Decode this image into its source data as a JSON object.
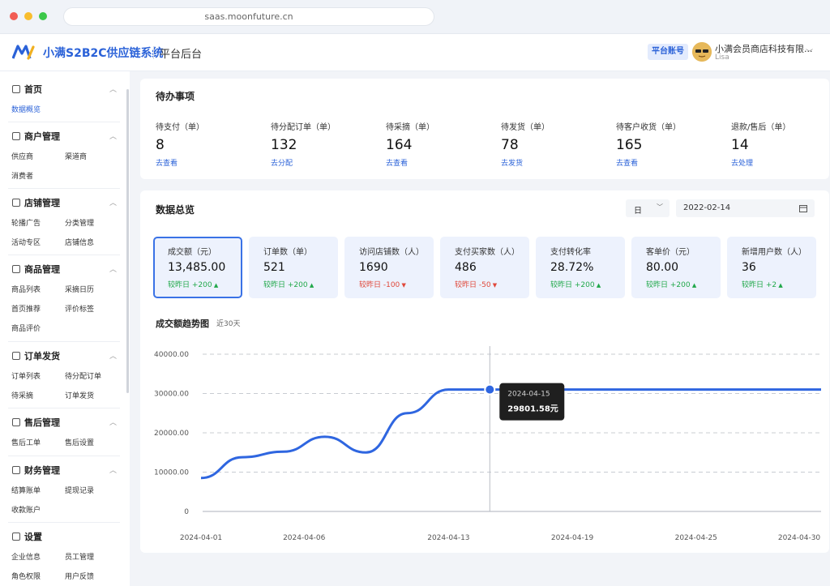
{
  "browser": {
    "url": "saas.moonfuture.cn"
  },
  "header": {
    "brand": "小满S2B2C供应链系统",
    "sub": "平台后台",
    "badge": "平台账号",
    "user_name": "小满会员商店科技有限...",
    "user_sub": "Lisa"
  },
  "sidebar": {
    "groups": [
      {
        "title": "首页",
        "items": [
          "数据概览"
        ]
      },
      {
        "title": "商户管理",
        "items": [
          "供应商",
          "渠道商",
          "消费者"
        ]
      },
      {
        "title": "店铺管理",
        "items": [
          "轮播广告",
          "分类管理",
          "活动专区",
          "店铺信息"
        ]
      },
      {
        "title": "商品管理",
        "items": [
          "商品列表",
          "采摘日历",
          "首页推荐",
          "评价标签",
          "商品评价"
        ]
      },
      {
        "title": "订单发货",
        "items": [
          "订单列表",
          "待分配订单",
          "待采摘",
          "订单发货"
        ]
      },
      {
        "title": "售后管理",
        "items": [
          "售后工单",
          "售后设置"
        ]
      },
      {
        "title": "财务管理",
        "items": [
          "结算账单",
          "提现记录",
          "收款账户"
        ]
      },
      {
        "title": "设置",
        "items": [
          "企业信息",
          "员工管理",
          "角色权限",
          "用户反馈"
        ]
      }
    ]
  },
  "todo": {
    "title": "待办事项",
    "items": [
      {
        "label": "待支付（单）",
        "value": "8",
        "link": "去查看"
      },
      {
        "label": "待分配订单（单）",
        "value": "132",
        "link": "去分配"
      },
      {
        "label": "待采摘（单）",
        "value": "164",
        "link": "去查看"
      },
      {
        "label": "待发货（单）",
        "value": "78",
        "link": "去发货"
      },
      {
        "label": "待客户收货（单）",
        "value": "165",
        "link": "去查看"
      },
      {
        "label": "退款/售后（单）",
        "value": "14",
        "link": "去处理"
      }
    ]
  },
  "overview": {
    "title": "数据总览",
    "period": "日",
    "date": "2022-02-14",
    "kpis": [
      {
        "label": "成交额（元）",
        "value": "13,485.00",
        "delta": "较昨日 +200",
        "trend": "up"
      },
      {
        "label": "订单数（单）",
        "value": "521",
        "delta": "较昨日 +200",
        "trend": "up"
      },
      {
        "label": "访问店铺数（人）",
        "value": "1690",
        "delta": "较昨日 -100",
        "trend": "down"
      },
      {
        "label": "支付买家数（人）",
        "value": "486",
        "delta": "较昨日 -50",
        "trend": "down"
      },
      {
        "label": "支付转化率",
        "value": "28.72%",
        "delta": "较昨日 +200",
        "trend": "up"
      },
      {
        "label": "客单价（元）",
        "value": "80.00",
        "delta": "较昨日 +200",
        "trend": "up"
      },
      {
        "label": "新增用户数（人）",
        "value": "36",
        "delta": "较昨日 +2",
        "trend": "up"
      }
    ]
  },
  "chart_data": {
    "type": "line",
    "title": "成交额趋势图",
    "subtitle": "近30天",
    "x": [
      "2024-04-01",
      "2024-04-03",
      "2024-04-05",
      "2024-04-07",
      "2024-04-09",
      "2024-04-11",
      "2024-04-13",
      "2024-04-15",
      "2024-04-19",
      "2024-04-25",
      "2024-04-30"
    ],
    "x_ticks": [
      "2024-04-01",
      "2024-04-06",
      "2024-04-13",
      "2024-04-19",
      "2024-04-25",
      "2024-04-30"
    ],
    "values": [
      8500,
      13800,
      15200,
      19000,
      15000,
      25000,
      31000,
      31000,
      31000,
      31000,
      31000
    ],
    "ylim": [
      0,
      40000
    ],
    "y_ticks": [
      "40000.00",
      "30000.00",
      "20000.00",
      "10000.00",
      "0"
    ],
    "grid": true,
    "color": "#2f66e0",
    "tooltip": {
      "date": "2024-04-15",
      "value": "29801.58元"
    }
  }
}
